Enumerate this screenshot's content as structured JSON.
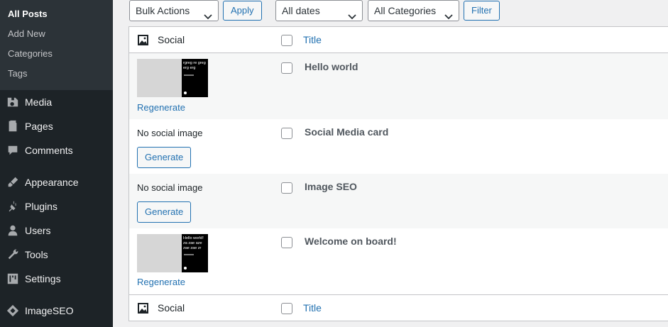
{
  "sidebar": {
    "submenu": [
      {
        "label": "All Posts",
        "current": true
      },
      {
        "label": "Add New"
      },
      {
        "label": "Categories"
      },
      {
        "label": "Tags"
      }
    ],
    "items": [
      {
        "label": "Media",
        "icon": "media-icon"
      },
      {
        "label": "Pages",
        "icon": "pages-icon"
      },
      {
        "label": "Comments",
        "icon": "comments-icon"
      },
      {
        "label": "Appearance",
        "icon": "appearance-icon"
      },
      {
        "label": "Plugins",
        "icon": "plugins-icon"
      },
      {
        "label": "Users",
        "icon": "users-icon"
      },
      {
        "label": "Tools",
        "icon": "tools-icon"
      },
      {
        "label": "Settings",
        "icon": "settings-icon"
      },
      {
        "label": "ImageSEO",
        "icon": "imageseo-icon"
      }
    ]
  },
  "toolbar": {
    "bulk_actions": "Bulk Actions",
    "apply": "Apply",
    "dates": "All dates",
    "categories": "All Categories",
    "filter": "Filter"
  },
  "table": {
    "col_social": "Social",
    "col_title": "Title",
    "rows": [
      {
        "title": "Hello world",
        "has_image": true,
        "thumb_text": "rgreg re greg erg erg",
        "action": "Regenerate"
      },
      {
        "title": "Social Media card",
        "has_image": false,
        "no_image_text": "No social image",
        "action": "Generate"
      },
      {
        "title": "Image SEO",
        "has_image": false,
        "no_image_text": "No social image",
        "action": "Generate"
      },
      {
        "title": "Welcome on board!",
        "has_image": true,
        "thumb_text": "Hello world! za zae aze zae zae zr",
        "action": "Regenerate"
      }
    ]
  },
  "colors": {
    "sidebar_bg": "#1d2327",
    "submenu_bg": "#2c3338",
    "accent": "#2271b1"
  }
}
